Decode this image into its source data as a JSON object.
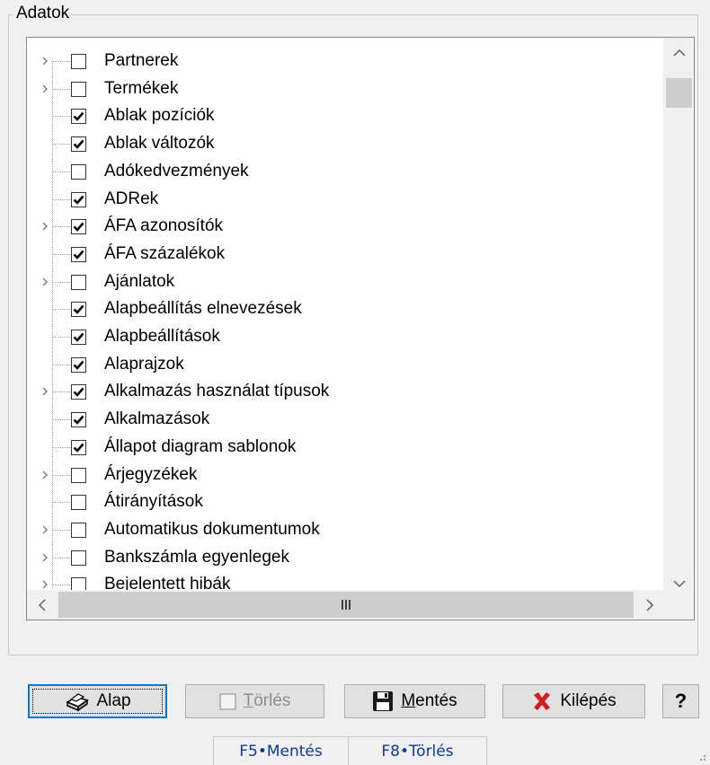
{
  "group": {
    "title": "Adatok"
  },
  "tree": {
    "items": [
      {
        "label": "Partnerek",
        "checked": false,
        "expandable": true
      },
      {
        "label": "Termékek",
        "checked": false,
        "expandable": true
      },
      {
        "label": "Ablak pozíciók",
        "checked": true,
        "expandable": false
      },
      {
        "label": "Ablak változók",
        "checked": true,
        "expandable": false
      },
      {
        "label": "Adókedvezmények",
        "checked": false,
        "expandable": false
      },
      {
        "label": "ADRek",
        "checked": true,
        "expandable": false
      },
      {
        "label": "ÁFA azonosítók",
        "checked": true,
        "expandable": true
      },
      {
        "label": "ÁFA százalékok",
        "checked": true,
        "expandable": false
      },
      {
        "label": "Ajánlatok",
        "checked": false,
        "expandable": true
      },
      {
        "label": "Alapbeállítás elnevezések",
        "checked": true,
        "expandable": false
      },
      {
        "label": "Alapbeállítások",
        "checked": true,
        "expandable": false
      },
      {
        "label": "Alaprajzok",
        "checked": true,
        "expandable": false
      },
      {
        "label": "Alkalmazás használat típusok",
        "checked": true,
        "expandable": true
      },
      {
        "label": "Alkalmazások",
        "checked": true,
        "expandable": false
      },
      {
        "label": "Állapot diagram sablonok",
        "checked": true,
        "expandable": false
      },
      {
        "label": "Árjegyzékek",
        "checked": false,
        "expandable": true
      },
      {
        "label": "Átirányítások",
        "checked": false,
        "expandable": false
      },
      {
        "label": "Automatikus dokumentumok",
        "checked": false,
        "expandable": true
      },
      {
        "label": "Bankszámla egyenlegek",
        "checked": false,
        "expandable": true
      },
      {
        "label": "Bejelentett hibák",
        "checked": false,
        "expandable": true
      }
    ]
  },
  "buttons": {
    "alap": {
      "label": "Alap",
      "icon": "printer-icon"
    },
    "torles": {
      "prefix": "",
      "underline": "T",
      "rest": "örlés",
      "icon": "checkbox-icon"
    },
    "mentes": {
      "underline": "M",
      "rest": "entés",
      "icon": "floppy-disk-icon"
    },
    "kilepes": {
      "label": "Kilépés",
      "icon": "red-x-icon"
    },
    "help": {
      "label": "?"
    }
  },
  "statusbar": {
    "f5": "F5•Mentés",
    "f8": "F8•Törlés"
  },
  "colors": {
    "accent": "#0078d7",
    "status_text": "#0b3a99",
    "exit_red": "#d01f1f"
  }
}
